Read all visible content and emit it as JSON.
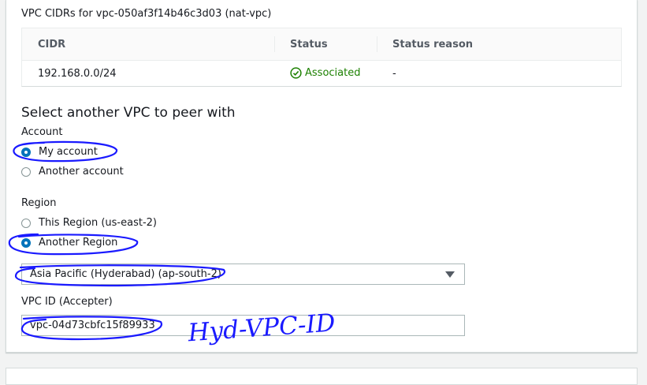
{
  "cidr_table": {
    "title": "VPC CIDRs for vpc-050af3f14b46c3d03 (nat-vpc)",
    "headers": [
      "CIDR",
      "Status",
      "Status reason"
    ],
    "rows": [
      {
        "cidr": "192.168.0.0/24",
        "status": "Associated",
        "reason": "-"
      }
    ]
  },
  "peer": {
    "section_title": "Select another VPC to peer with",
    "account_label": "Account",
    "account_options": [
      "My account",
      "Another account"
    ],
    "account_selected": "My account",
    "region_label": "Region",
    "region_options": [
      "This Region (us-east-2)",
      "Another Region"
    ],
    "region_selected": "Another Region",
    "region_select_value": "Asia Pacific (Hyderabad) (ap-south-2)",
    "vpc_id_label": "VPC ID (Accepter)",
    "vpc_id_value": "vpc-04d73cbfc15f89933"
  },
  "annotation": {
    "handwritten_note": "Hyd-VPC-ID",
    "ink_color": "#1a1aff"
  },
  "colors": {
    "status_ok": "#1d8102",
    "radio_selected": "#0073bb"
  }
}
